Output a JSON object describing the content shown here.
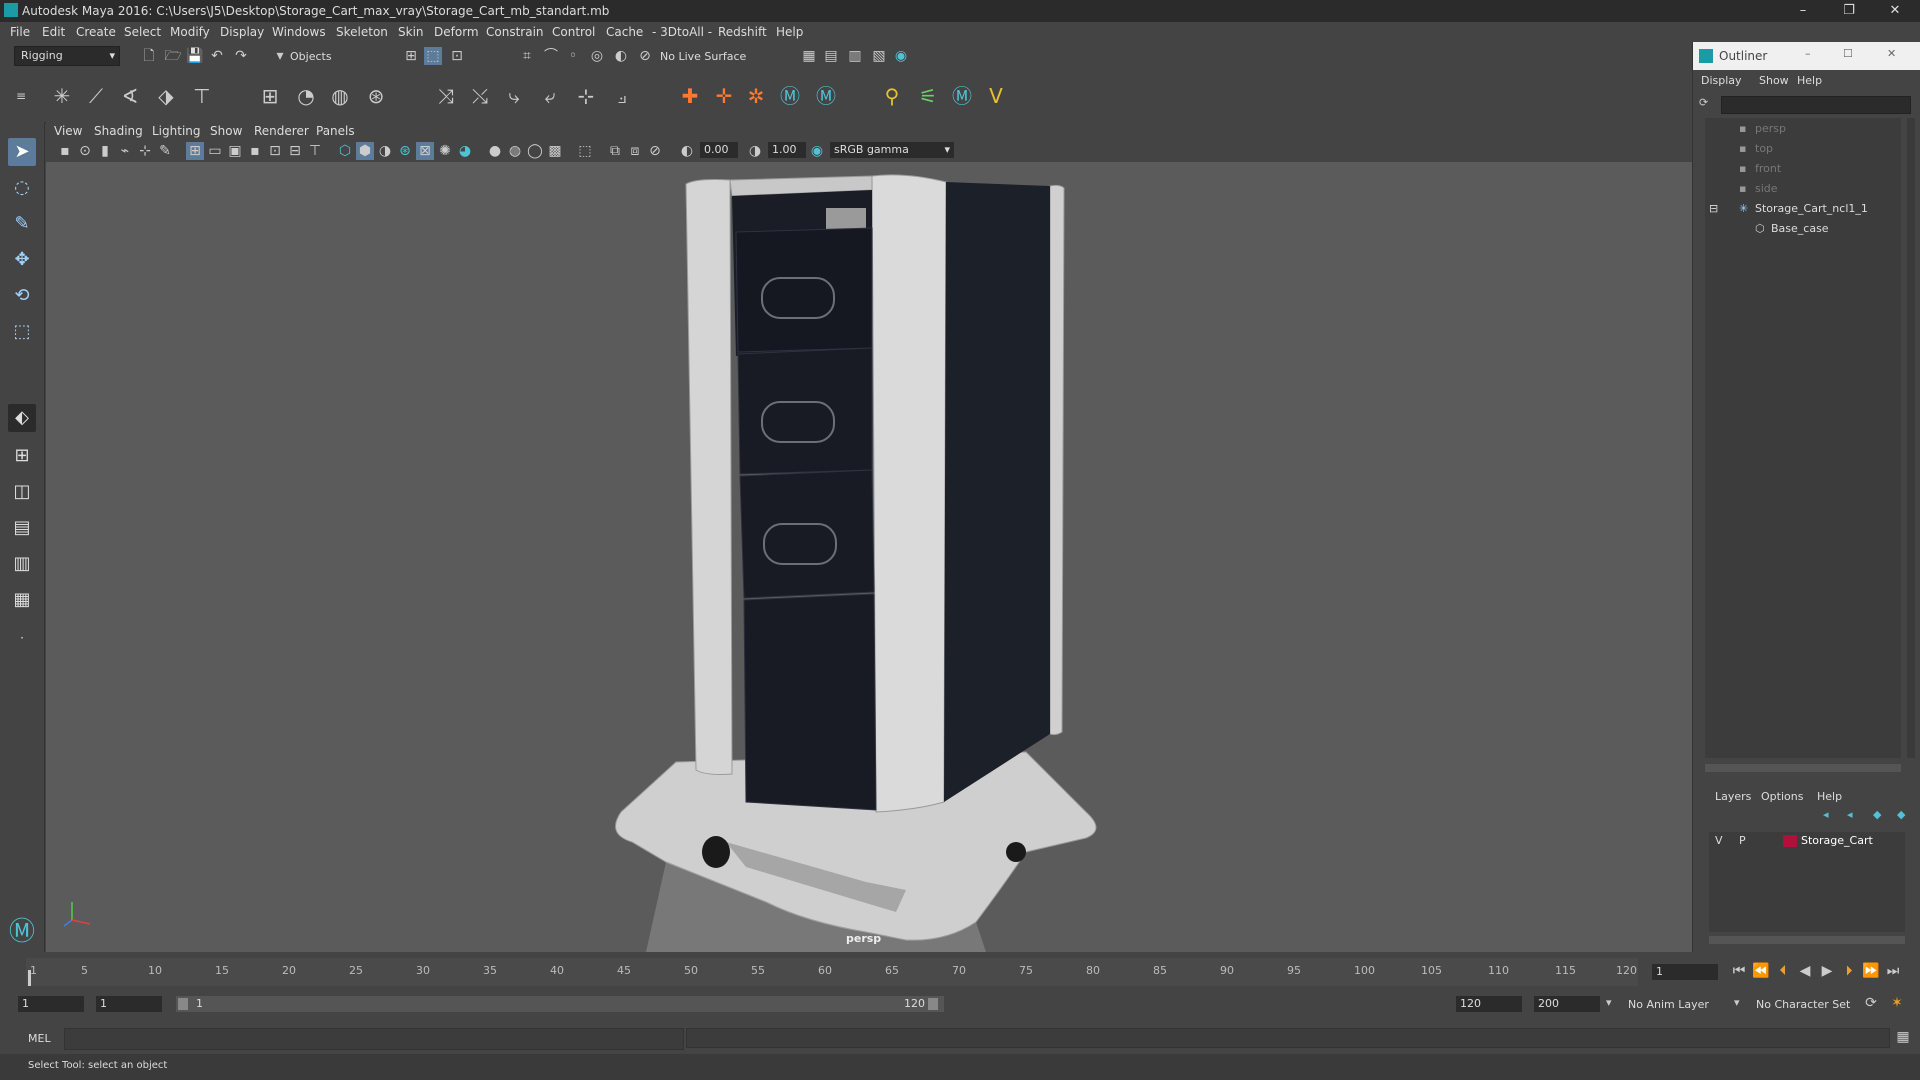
{
  "window": {
    "title": "Autodesk Maya 2016: C:\\Users\\J5\\Desktop\\Storage_Cart_max_vray\\Storage_Cart_mb_standart.mb",
    "minimize": "–",
    "restore": "❐",
    "close": "✕"
  },
  "menubar": {
    "items": [
      "File",
      "Edit",
      "Create",
      "Select",
      "Modify",
      "Display",
      "Windows",
      "Skeleton",
      "Skin",
      "Deform",
      "Constrain",
      "Control",
      "Cache",
      "- 3DtoAll -",
      "Redshift",
      "Help"
    ]
  },
  "statusline": {
    "menuset": "Rigging",
    "selection_mode": "Objects",
    "live_surface": "No Live Surface"
  },
  "viewport": {
    "menu": [
      "View",
      "Shading",
      "Lighting",
      "Show",
      "Renderer",
      "Panels"
    ],
    "exposure": "0.00",
    "gamma": "1.00",
    "colorspace": "sRGB gamma",
    "camera_label": "persp"
  },
  "outliner": {
    "title": "Outliner",
    "menu": [
      "Display",
      "Show",
      "Help"
    ],
    "items": [
      {
        "label": "persp",
        "indent": 0,
        "dim": true
      },
      {
        "label": "top",
        "indent": 0,
        "dim": true
      },
      {
        "label": "front",
        "indent": 0,
        "dim": true
      },
      {
        "label": "side",
        "indent": 0,
        "dim": true
      },
      {
        "label": "Storage_Cart_ncl1_1",
        "indent": 0,
        "dim": false
      },
      {
        "label": "Base_case",
        "indent": 1,
        "dim": false
      }
    ]
  },
  "layers": {
    "menu": [
      "Layers",
      "Options",
      "Help"
    ],
    "row": {
      "v": "V",
      "p": "P",
      "name": "Storage_Cart",
      "color": "#b0103a"
    }
  },
  "timeslider": {
    "ticks": [
      "1",
      "5",
      "10",
      "15",
      "20",
      "25",
      "30",
      "35",
      "40",
      "45",
      "50",
      "55",
      "60",
      "65",
      "70",
      "75",
      "80",
      "85",
      "90",
      "95",
      "100",
      "105",
      "110",
      "115",
      "120"
    ],
    "current_frame": "1"
  },
  "range": {
    "start": "1",
    "anim_start": "1",
    "range_start_label": "1",
    "range_end_label": "120",
    "end": "120",
    "anim_end": "200",
    "anim_layer": "No Anim Layer",
    "char_set": "No Character Set"
  },
  "cmdline": {
    "label": "MEL"
  },
  "helpline": {
    "text": "Select Tool: select an object"
  },
  "colors": {
    "accent": "#1b9aa8",
    "layer": "#b0103a"
  }
}
